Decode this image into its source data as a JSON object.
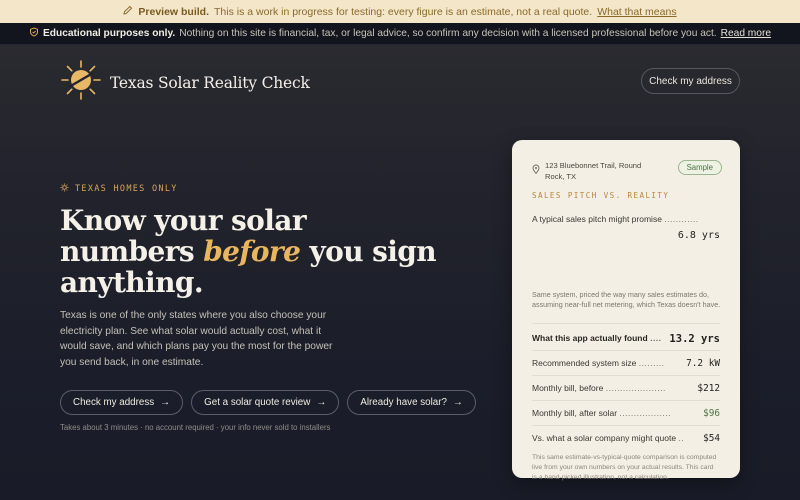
{
  "preview": {
    "icon": "pencil-icon",
    "bold": "Preview build.",
    "text": "This is a work in progress for testing: every figure is an estimate, not a real quote.",
    "link": "What that means"
  },
  "edu": {
    "icon": "shield-icon",
    "bold": "Educational purposes only.",
    "text": "Nothing on this site is financial, tax, or legal advice, so confirm any decision with a licensed professional before you act.",
    "link": "Read more"
  },
  "brand": {
    "name": "Texas Solar Reality Check",
    "icon": "sun-logo-icon"
  },
  "nav": {
    "cta": "Check my address"
  },
  "hero": {
    "eyebrow": "TEXAS HOMES ONLY",
    "headline_before": "Know your solar numbers ",
    "headline_emph": "before",
    "headline_after": " you sign anything.",
    "lede": "Texas is one of the only states where you also choose your electricity plan. See what solar would actually cost, what it would save, and which plans pay you the most for the power you send back, in one estimate.",
    "ctas": [
      "Check my address",
      "Get a solar quote review",
      "Already have solar?"
    ],
    "footnote": "Takes about 3 minutes · no account required · your info never sold to installers"
  },
  "card": {
    "address": "123 Bluebonnet Trail, Round Rock, TX",
    "badge": "Sample",
    "section_title": "SALES PITCH VS. REALITY",
    "pitch_label": "A typical sales pitch might promise",
    "pitch_value": "6.8 yrs",
    "pitch_note": "Same system, priced the way many sales estimates do, assuming near-full net metering, which Texas doesn't have.",
    "rows": [
      {
        "label": "What this app actually found",
        "value": "13.2 yrs"
      },
      {
        "label": "Recommended system size",
        "value": "7.2 kW"
      },
      {
        "label": "Monthly bill, before",
        "value": "$212"
      },
      {
        "label": "Monthly bill, after solar",
        "value": "$96"
      },
      {
        "label": "Vs. what a solar company might quote",
        "value": "$54"
      }
    ],
    "note": "This same estimate-vs-typical-quote comparison is computed live from your own numbers on your actual results. This card is a hand-picked illustration, not a calculation."
  },
  "colors": {
    "accent": "#e8b65f",
    "green": "#4e7346",
    "background": "#1a1d26",
    "card": "#f4efe4"
  }
}
